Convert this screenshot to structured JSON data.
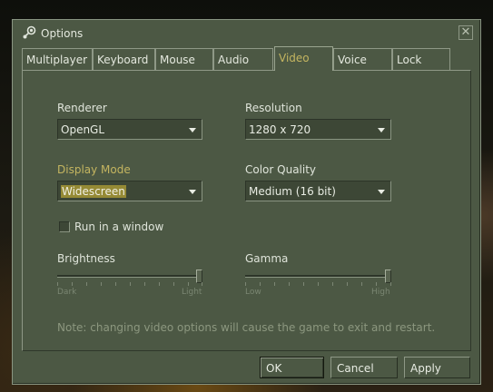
{
  "window": {
    "title": "Options",
    "close_symbol": "✕"
  },
  "tabs": [
    {
      "label": "Multiplayer",
      "active": false
    },
    {
      "label": "Keyboard",
      "active": false
    },
    {
      "label": "Mouse",
      "active": false
    },
    {
      "label": "Audio",
      "active": false
    },
    {
      "label": "Video",
      "active": true
    },
    {
      "label": "Voice",
      "active": false
    },
    {
      "label": "Lock",
      "active": false
    }
  ],
  "video": {
    "renderer": {
      "label": "Renderer",
      "value": "OpenGL"
    },
    "resolution": {
      "label": "Resolution",
      "value": "1280 x 720"
    },
    "display_mode": {
      "label": "Display Mode",
      "value": "Widescreen"
    },
    "color_quality": {
      "label": "Color Quality",
      "value": "Medium (16 bit)"
    },
    "run_in_window": {
      "label": "Run in a window",
      "checked": false
    },
    "brightness": {
      "label": "Brightness",
      "min_label": "Dark",
      "max_label": "Light",
      "level": 1.0
    },
    "gamma": {
      "label": "Gamma",
      "min_label": "Low",
      "max_label": "High",
      "level": 1.0
    },
    "note": "Note: changing video options will cause the game to exit and restart."
  },
  "buttons": {
    "ok": "OK",
    "cancel": "Cancel",
    "apply": "Apply"
  },
  "colors": {
    "panel": "#4c5844",
    "highlight_text": "#c4b560",
    "selection": "#958a35"
  },
  "icons": {
    "app": "steam-icon",
    "close": "close-icon",
    "dropdown": "chevron-down-icon"
  }
}
